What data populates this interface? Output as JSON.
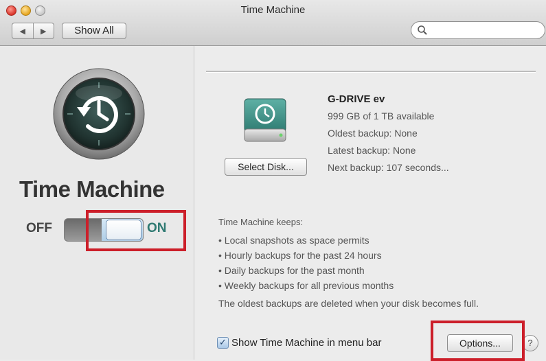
{
  "window": {
    "title": "Time Machine"
  },
  "toolbar": {
    "back_glyph": "◀",
    "forward_glyph": "▶",
    "show_all_label": "Show All",
    "search_placeholder": "",
    "search_icon": "search-icon"
  },
  "left_panel": {
    "app_name": "Time Machine",
    "logo_icon": "time-machine-icon",
    "switch": {
      "off_label": "OFF",
      "on_label": "ON",
      "state": "on"
    }
  },
  "disk": {
    "icon": "external-drive-icon",
    "name": "G-DRIVE ev",
    "capacity": "999 GB of 1 TB available",
    "oldest_backup": "Oldest backup: None",
    "latest_backup": "Latest backup: None",
    "next_backup": "Next backup: 107 seconds...",
    "select_disk_label": "Select Disk..."
  },
  "info": {
    "keeps_heading": "Time Machine keeps:",
    "bullets": [
      "• Local snapshots as space permits",
      "• Hourly backups for the past 24 hours",
      "• Daily backups for the past month",
      "• Weekly backups for all previous months"
    ],
    "note": "The oldest backups are deleted when your disk becomes full."
  },
  "footer": {
    "menubar_checkbox_checked": true,
    "menubar_checkbox_mark": "✓",
    "menubar_label": "Show Time Machine in menu bar",
    "options_label": "Options...",
    "help_label": "?"
  },
  "colors": {
    "highlight": "#cc1f2a",
    "on_text": "#2f7a72",
    "drive_teal": "#3e8f85"
  }
}
